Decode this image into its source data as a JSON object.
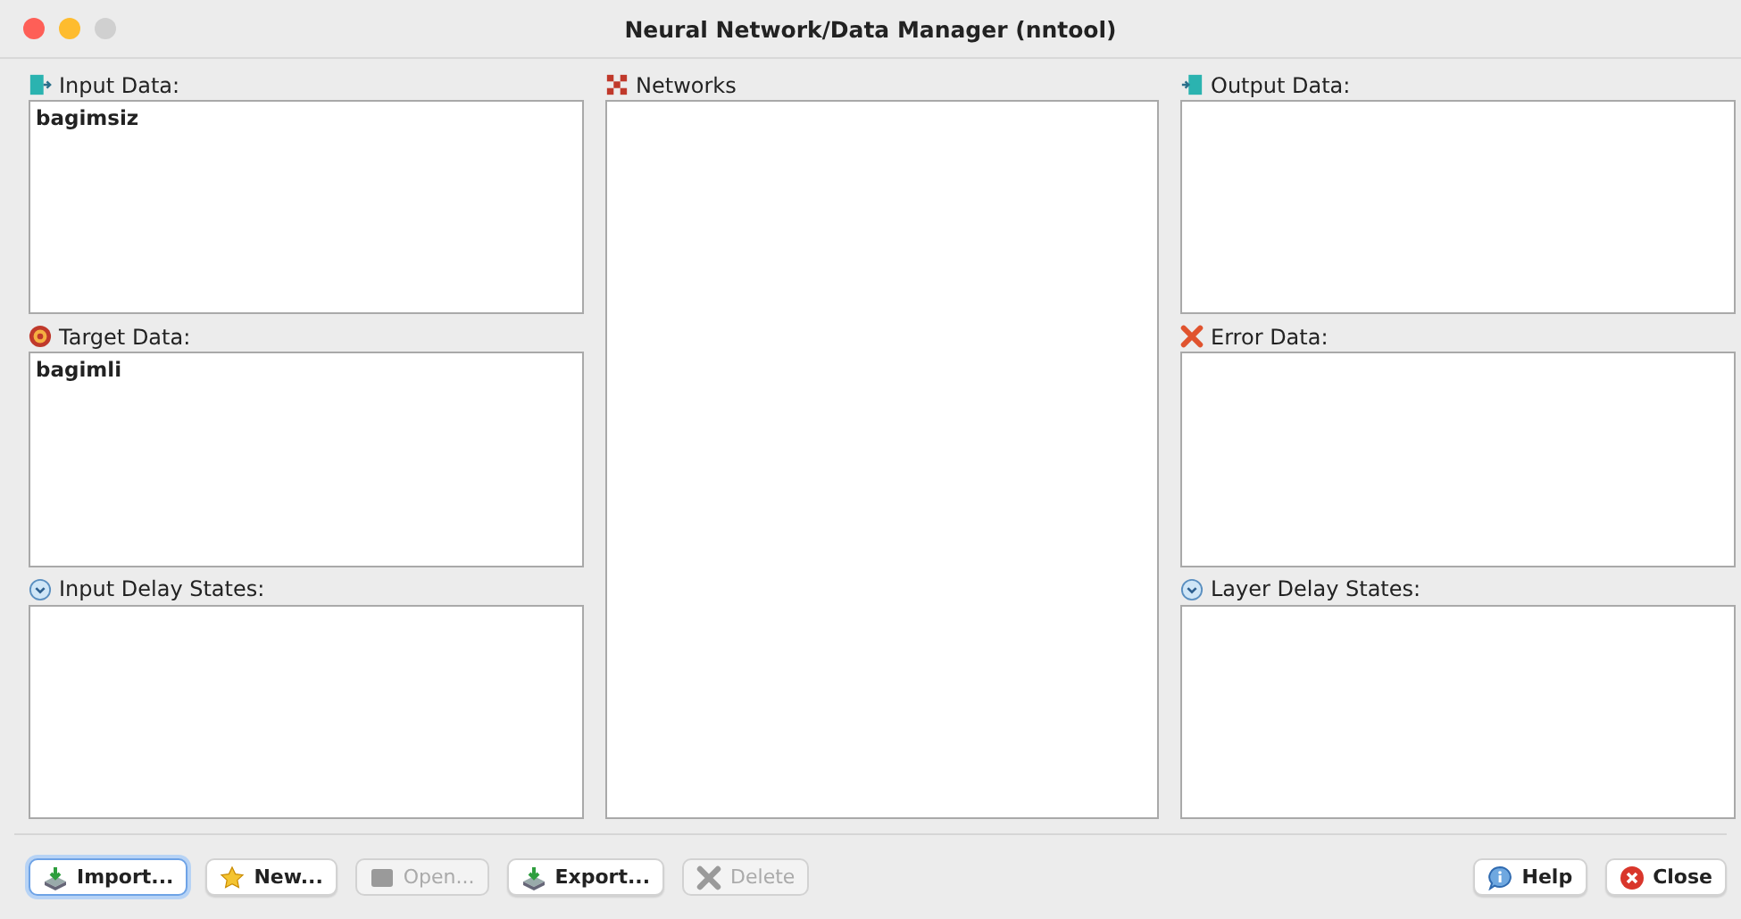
{
  "window": {
    "title": "Neural Network/Data Manager (nntool)"
  },
  "columns": [
    {
      "panels": [
        {
          "kind": "input",
          "label": "Input Data:",
          "items": [
            "bagimsiz"
          ]
        },
        {
          "kind": "target",
          "label": "Target Data:",
          "items": [
            "bagimli"
          ]
        },
        {
          "kind": "delay",
          "label": "Input Delay States:"
        }
      ]
    },
    {
      "panels": [
        {
          "kind": "network",
          "label": "Networks"
        }
      ]
    },
    {
      "panels": [
        {
          "kind": "output",
          "label": "Output Data:"
        },
        {
          "kind": "error",
          "label": "Error Data:"
        },
        {
          "kind": "delay",
          "label": "Layer Delay States:"
        }
      ]
    }
  ],
  "buttons_left": [
    {
      "kind": "import",
      "label": "Import...",
      "disabled": false,
      "focused": true
    },
    {
      "kind": "new",
      "label": "New...",
      "disabled": false,
      "focused": false
    },
    {
      "kind": "open",
      "label": "Open...",
      "disabled": true,
      "focused": false
    },
    {
      "kind": "export",
      "label": "Export...",
      "disabled": false,
      "focused": false
    },
    {
      "kind": "delete",
      "label": "Delete",
      "disabled": true,
      "focused": false
    }
  ],
  "buttons_right": [
    {
      "kind": "help",
      "label": "Help",
      "disabled": false,
      "focused": false
    },
    {
      "kind": "close",
      "label": "Close",
      "disabled": false,
      "focused": false
    }
  ]
}
